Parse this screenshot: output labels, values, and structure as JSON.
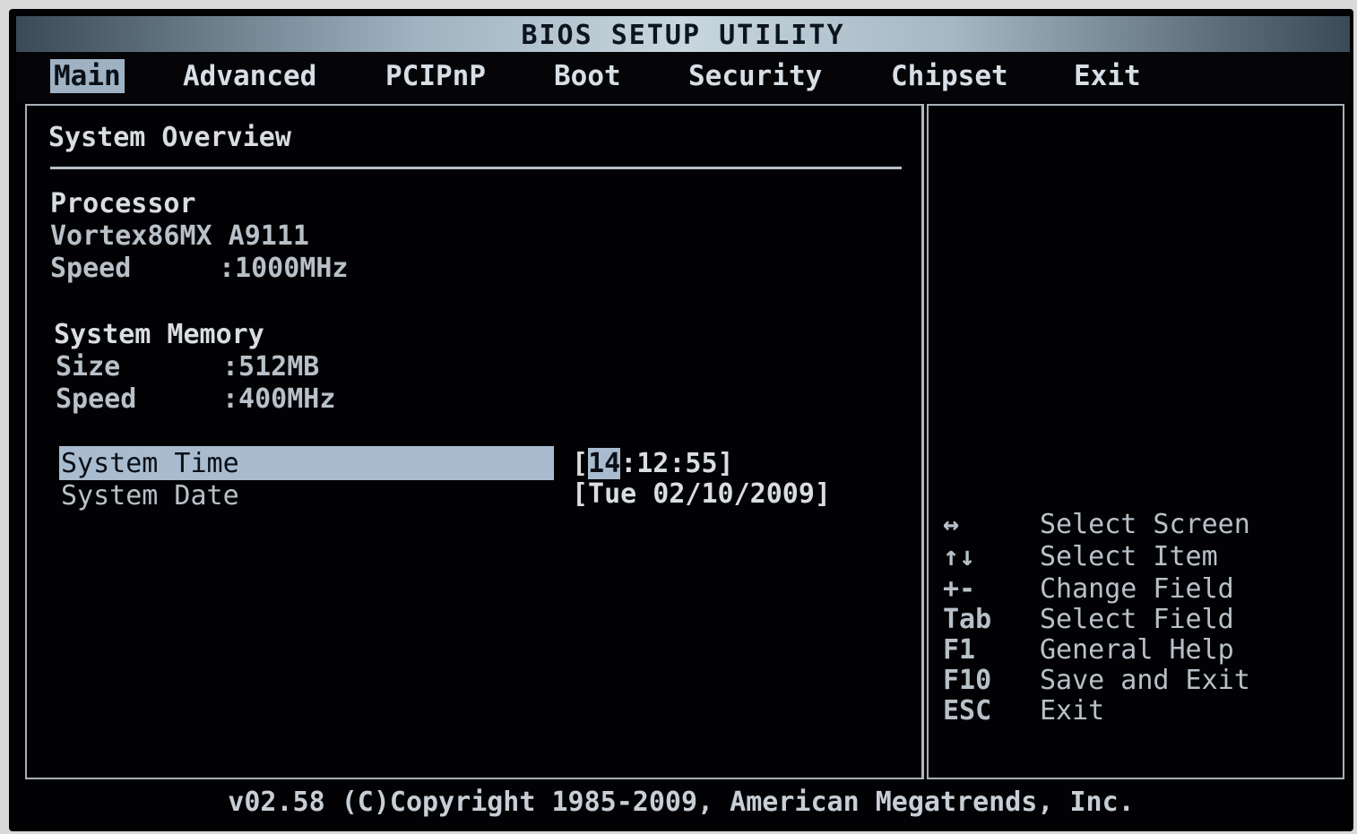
{
  "title": "BIOS SETUP UTILITY",
  "menu": [
    "Main",
    "Advanced",
    "PCIPnP",
    "Boot",
    "Security",
    "Chipset",
    "Exit"
  ],
  "main": {
    "section_title": "System Overview",
    "processor": {
      "heading": "Processor",
      "model": "Vortex86MX A9111",
      "speed_label": "Speed",
      "speed_value": ":1000MHz"
    },
    "memory": {
      "heading": "System Memory",
      "size_label": "Size",
      "size_value": ":512MB",
      "speed_label": "Speed",
      "speed_value": ":400MHz"
    },
    "time": {
      "label": "System Time",
      "open": "[",
      "hour": "14",
      "rest": ":12:55]"
    },
    "date": {
      "label": "System Date",
      "value": "[Tue 02/10/2009]"
    }
  },
  "help": [
    {
      "key": "↔",
      "desc": "Select Screen"
    },
    {
      "key": "↑↓",
      "desc": "Select Item"
    },
    {
      "key": "+-",
      "desc": "Change Field"
    },
    {
      "key": "Tab",
      "desc": "Select Field"
    },
    {
      "key": "F1",
      "desc": "General Help"
    },
    {
      "key": "F10",
      "desc": "Save and Exit"
    },
    {
      "key": "ESC",
      "desc": "Exit"
    }
  ],
  "footer": "v02.58 (C)Copyright 1985-2009, American Megatrends, Inc.",
  "colors": {
    "background": "#020204",
    "highlight": "#a9bccf",
    "text": "#d9dde2"
  }
}
